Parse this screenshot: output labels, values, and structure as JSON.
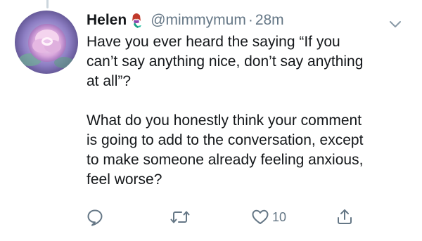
{
  "tweet": {
    "display_name": "Helen",
    "handle": "@mimmymum",
    "separator": "·",
    "time": "28m",
    "paragraphs": [
      "Have you ever heard the saying “If you\ncan’t say anything nice, don’t say anything\nat all”?",
      "What do you honestly think your comment\nis going to add to the conversation, except\nto make someone already feeling anxious,\nfeel worse?"
    ],
    "name_emoji": "mermaid-emoji",
    "avatar_image": "purple-rose-avatar"
  },
  "actions": {
    "reply_icon": "reply-icon",
    "retweet_icon": "retweet-icon",
    "like_icon": "heart-icon",
    "like_count": "10",
    "share_icon": "share-icon"
  },
  "colors": {
    "text": "#14171a",
    "secondary": "#657786",
    "thread_line": "#ccd6dd"
  }
}
